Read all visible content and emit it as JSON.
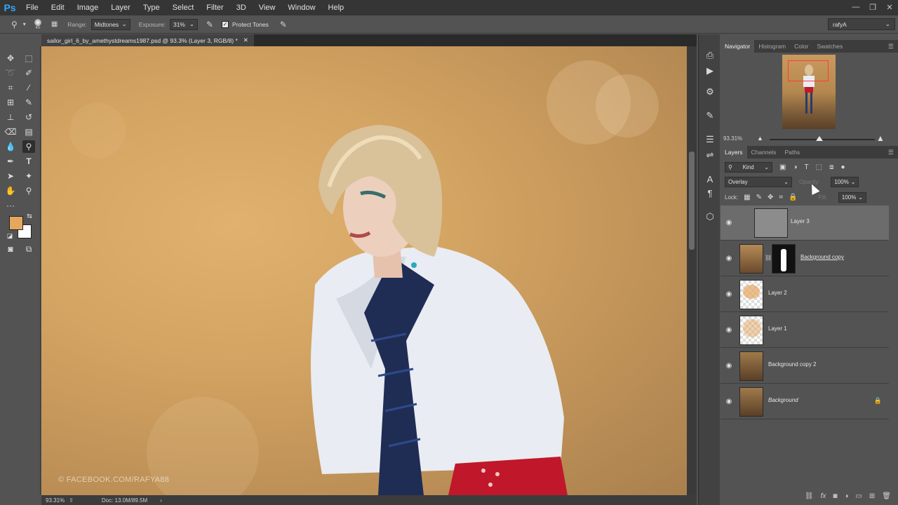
{
  "app": {
    "logo": "Ps"
  },
  "menu": [
    "File",
    "Edit",
    "Image",
    "Layer",
    "Type",
    "Select",
    "Filter",
    "3D",
    "View",
    "Window",
    "Help"
  ],
  "window_controls": {
    "minimize": "—",
    "restore": "❐",
    "close": "✕"
  },
  "options": {
    "brush_size": "40",
    "range_label": "Range:",
    "range_value": "Midtones",
    "exposure_label": "Exposure:",
    "exposure_value": "31%",
    "protect_tones_label": "Protect Tones",
    "workspace": "rafyA"
  },
  "document": {
    "tab_title": "sailor_girl_6_by_amethystdreams1987.psd @ 93.3% (Layer 3, RGB/8) *",
    "watermark": "© FACEBOOK.COM/RAFYA88"
  },
  "status": {
    "zoom": "93.31%",
    "doc_size": "Doc: 13.0M/89.5M"
  },
  "colors": {
    "foreground": "#e5a65e",
    "background": "#ffffff"
  },
  "navigator": {
    "tabs": [
      "Navigator",
      "Histogram",
      "Color",
      "Swatches"
    ],
    "zoom": "93.31%"
  },
  "layers_panel": {
    "tabs": [
      "Layers",
      "Channels",
      "Paths"
    ],
    "filter_kind": "Kind",
    "blend_mode": "Overlay",
    "opacity_label": "Opacity:",
    "opacity_value": "100%",
    "lock_label": "Lock:",
    "fill_label": "Fill:",
    "fill_value": "100%",
    "layers": [
      {
        "name": "Layer 3",
        "selected": true,
        "locked": false
      },
      {
        "name": "Background copy",
        "selected": false,
        "locked": false
      },
      {
        "name": "Layer 2",
        "selected": false,
        "locked": false
      },
      {
        "name": "Layer 1",
        "selected": false,
        "locked": false
      },
      {
        "name": "Background copy 2",
        "selected": false,
        "locked": false
      },
      {
        "name": "Background",
        "selected": false,
        "locked": true
      }
    ]
  }
}
